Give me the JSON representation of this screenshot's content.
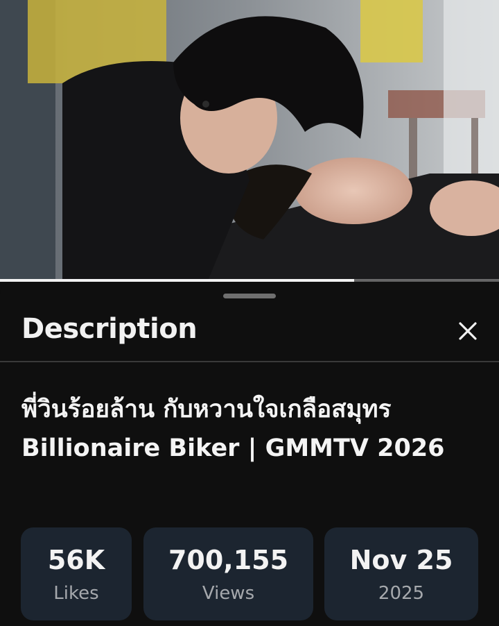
{
  "sheet": {
    "title": "Description",
    "close_icon": "close-icon"
  },
  "video": {
    "title": "พี่วินร้อยล้าน กับหวานใจเกลือสมุทร Billionaire Biker | GMMTV 2026",
    "progress_fraction": 0.71
  },
  "stats": [
    {
      "value": "56K",
      "label": "Likes"
    },
    {
      "value": "700,155",
      "label": "Views"
    },
    {
      "value": "Nov 25",
      "label": "2025"
    }
  ]
}
